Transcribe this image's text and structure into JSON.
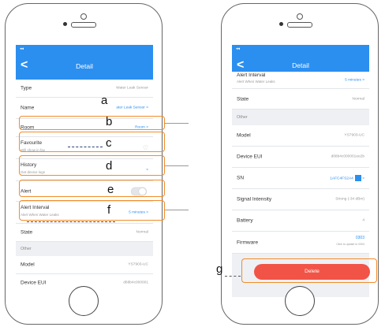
{
  "left_screen": {
    "title": "Detail",
    "back_glyph": "<",
    "signal_glyph": "◂◂",
    "rows": [
      {
        "label": "Type",
        "value": "Water Leak Sensor"
      },
      {
        "label": "Name",
        "value": "ater Leak Sensor >"
      },
      {
        "label": "Room",
        "value": "Room >"
      },
      {
        "label": "Favourite",
        "sub": "Will show in fav"
      },
      {
        "label": "History",
        "sub": "Get device logs",
        "value": ">"
      },
      {
        "label": "Alert"
      },
      {
        "label": "Alert Interval",
        "sub": "Alert When Water Leaks",
        "value": "5 minutes >"
      },
      {
        "label": "State",
        "value": "Normal"
      },
      {
        "group": "Other"
      },
      {
        "label": "Model",
        "value": "YS7903-UC"
      },
      {
        "label": "Device EUI",
        "value": "d88b4c000001"
      }
    ],
    "favourite_icon": "heart-icon",
    "alert_toggle_on": false
  },
  "right_screen": {
    "title": "Detail",
    "back_glyph": "<",
    "signal_glyph": "◂◂",
    "rows": [
      {
        "label": "Alert Interval",
        "sub": "Alert When Water Leaks",
        "value": "5 minutes >"
      },
      {
        "label": "State",
        "value": "Normal"
      },
      {
        "group": "Other"
      },
      {
        "label": "Model",
        "value": "YS7903-UC"
      },
      {
        "label": "Device EUI",
        "value": "d88b4c000001ee2b"
      },
      {
        "label": "SN",
        "value": "1AFC4FS2A4",
        "arrow": ">"
      },
      {
        "label": "Signal Intensity",
        "value": "Strong (-34 dBm)"
      },
      {
        "label": "Battery",
        "value": "4"
      },
      {
        "label": "Firmware",
        "value": "0303",
        "sub": "Click to update to 0304"
      }
    ],
    "delete_label": "Delete"
  },
  "annotations": {
    "a": "a",
    "b": "b",
    "c": "c",
    "d": "d",
    "e": "e",
    "f": "f",
    "g": "g"
  },
  "colors": {
    "accent": "#2b8ff0",
    "highlight": "#f28c28",
    "delete": "#f25347",
    "dashed_leader": "#2a3f78"
  }
}
